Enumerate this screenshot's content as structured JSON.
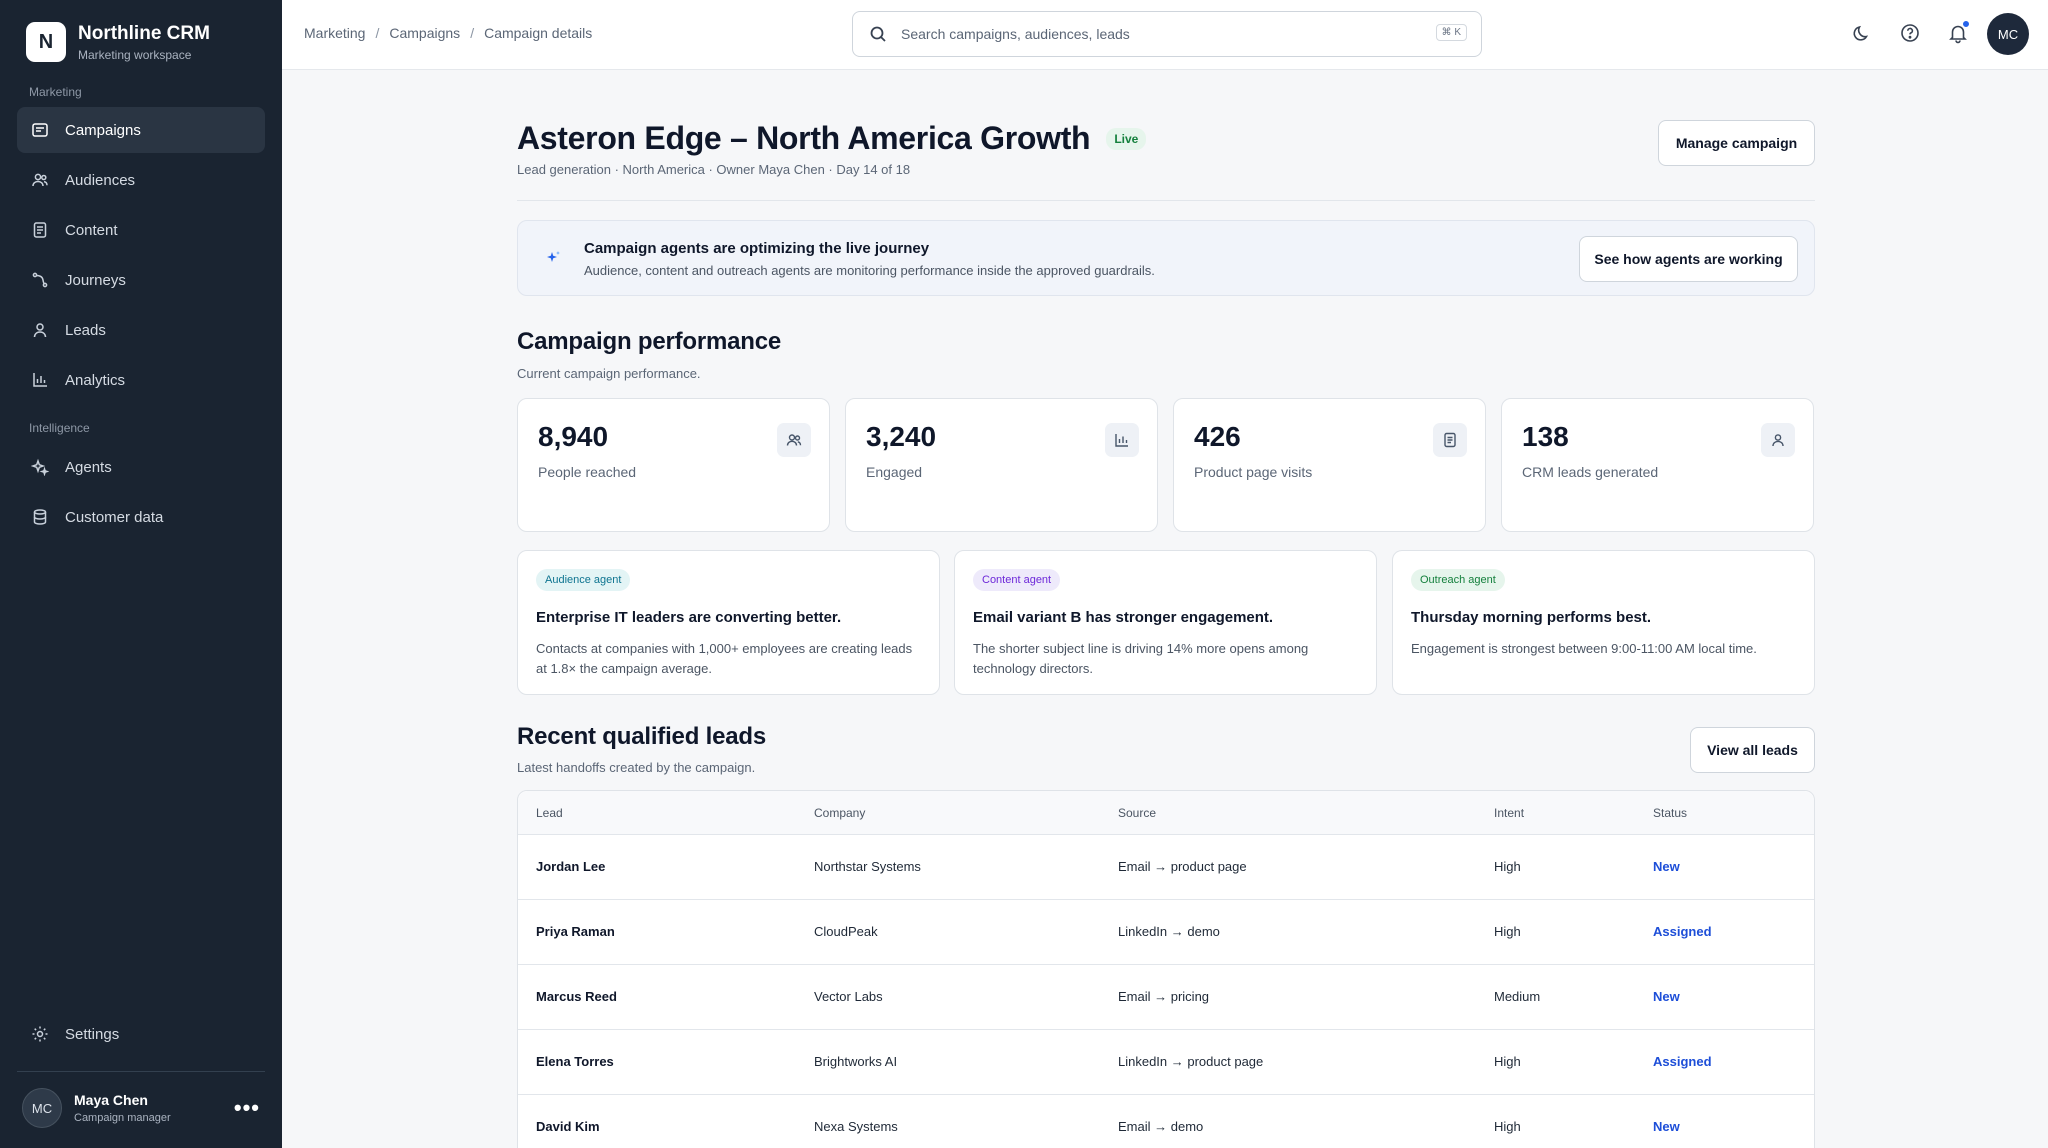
{
  "brand": {
    "logo_letter": "N",
    "name": "Northline CRM",
    "subtitle": "Marketing workspace"
  },
  "sidebar": {
    "section_marketing": "Marketing",
    "section_intelligence": "Intelligence",
    "items": [
      {
        "label": "Campaigns",
        "icon": "campaign-icon",
        "active": true
      },
      {
        "label": "Audiences",
        "icon": "users-icon"
      },
      {
        "label": "Content",
        "icon": "document-icon"
      },
      {
        "label": "Journeys",
        "icon": "route-icon"
      },
      {
        "label": "Leads",
        "icon": "person-icon"
      },
      {
        "label": "Analytics",
        "icon": "bar-chart-icon"
      },
      {
        "label": "Agents",
        "icon": "sparkles-icon"
      },
      {
        "label": "Customer data",
        "icon": "database-icon"
      }
    ],
    "settings_label": "Settings",
    "user": {
      "initials": "MC",
      "name": "Maya Chen",
      "role": "Campaign manager"
    }
  },
  "topbar": {
    "breadcrumb": [
      "Marketing",
      "Campaigns",
      "Campaign details"
    ],
    "breadcrumb_sep": "/",
    "search_placeholder": "Search campaigns, audiences, leads",
    "search_shortcut": "⌘ K",
    "avatar_initials": "MC"
  },
  "campaign": {
    "title": "Asteron Edge – North America Growth",
    "status": "Live",
    "subtitle": "Lead generation · North America · Owner Maya Chen · Day 14 of 18",
    "manage_label": "Manage campaign"
  },
  "agent_banner": {
    "title": "Campaign agents are optimizing the live journey",
    "text": "Audience, content and outreach agents are monitoring performance inside the approved guardrails.",
    "button_label": "See how agents are working"
  },
  "performance": {
    "title": "Campaign performance",
    "subtitle": "Current campaign performance.",
    "stats": [
      {
        "value": "8,940",
        "label": "People reached",
        "icon": "users-icon"
      },
      {
        "value": "3,240",
        "label": "Engaged",
        "icon": "bar-chart-icon"
      },
      {
        "value": "426",
        "label": "Product page visits",
        "icon": "document-icon"
      },
      {
        "value": "138",
        "label": "CRM leads generated",
        "icon": "person-icon"
      }
    ]
  },
  "insights": [
    {
      "tag": "Audience agent",
      "title": "Enterprise IT leaders are converting better.",
      "text": "Contacts at companies with 1,000+ employees are creating leads at 1.8× the campaign average."
    },
    {
      "tag": "Content agent",
      "title": "Email variant B has stronger engagement.",
      "text": "The shorter subject line is driving 14% more opens among technology directors."
    },
    {
      "tag": "Outreach agent",
      "title": "Thursday morning performs best.",
      "text": "Engagement is strongest between 9:00-11:00 AM local time."
    }
  ],
  "leads": {
    "title": "Recent qualified leads",
    "subtitle": "Latest handoffs created by the campaign.",
    "view_all_label": "View all leads",
    "columns": [
      "Lead",
      "Company",
      "Source",
      "Intent",
      "Status"
    ],
    "rows": [
      {
        "lead": "Jordan Lee",
        "company": "Northstar Systems",
        "source": "Email → product page",
        "intent": "High",
        "status": "New"
      },
      {
        "lead": "Priya Raman",
        "company": "CloudPeak",
        "source": "LinkedIn → demo",
        "intent": "High",
        "status": "Assigned"
      },
      {
        "lead": "Marcus Reed",
        "company": "Vector Labs",
        "source": "Email → pricing",
        "intent": "Medium",
        "status": "New"
      },
      {
        "lead": "Elena Torres",
        "company": "Brightworks AI",
        "source": "LinkedIn → product page",
        "intent": "High",
        "status": "Assigned"
      },
      {
        "lead": "David Kim",
        "company": "Nexa Systems",
        "source": "Email → demo",
        "intent": "High",
        "status": "New"
      }
    ]
  },
  "colors": {
    "sidebar_bg": "#1a2431",
    "accent": "#1d4ed8",
    "live": "#15803d",
    "notification_dot": "#2563eb"
  }
}
